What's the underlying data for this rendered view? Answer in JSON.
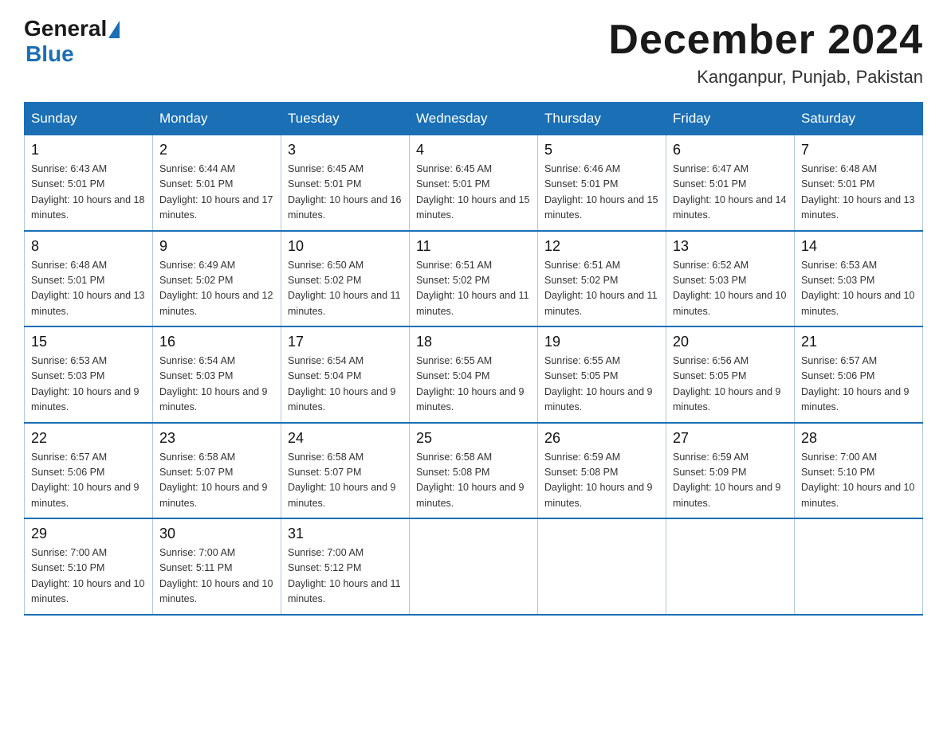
{
  "header": {
    "logo_general": "General",
    "logo_blue": "Blue",
    "title": "December 2024",
    "subtitle": "Kanganpur, Punjab, Pakistan"
  },
  "weekdays": [
    "Sunday",
    "Monday",
    "Tuesday",
    "Wednesday",
    "Thursday",
    "Friday",
    "Saturday"
  ],
  "weeks": [
    [
      {
        "day": "1",
        "sunrise": "6:43 AM",
        "sunset": "5:01 PM",
        "daylight": "10 hours and 18 minutes."
      },
      {
        "day": "2",
        "sunrise": "6:44 AM",
        "sunset": "5:01 PM",
        "daylight": "10 hours and 17 minutes."
      },
      {
        "day": "3",
        "sunrise": "6:45 AM",
        "sunset": "5:01 PM",
        "daylight": "10 hours and 16 minutes."
      },
      {
        "day": "4",
        "sunrise": "6:45 AM",
        "sunset": "5:01 PM",
        "daylight": "10 hours and 15 minutes."
      },
      {
        "day": "5",
        "sunrise": "6:46 AM",
        "sunset": "5:01 PM",
        "daylight": "10 hours and 15 minutes."
      },
      {
        "day": "6",
        "sunrise": "6:47 AM",
        "sunset": "5:01 PM",
        "daylight": "10 hours and 14 minutes."
      },
      {
        "day": "7",
        "sunrise": "6:48 AM",
        "sunset": "5:01 PM",
        "daylight": "10 hours and 13 minutes."
      }
    ],
    [
      {
        "day": "8",
        "sunrise": "6:48 AM",
        "sunset": "5:01 PM",
        "daylight": "10 hours and 13 minutes."
      },
      {
        "day": "9",
        "sunrise": "6:49 AM",
        "sunset": "5:02 PM",
        "daylight": "10 hours and 12 minutes."
      },
      {
        "day": "10",
        "sunrise": "6:50 AM",
        "sunset": "5:02 PM",
        "daylight": "10 hours and 11 minutes."
      },
      {
        "day": "11",
        "sunrise": "6:51 AM",
        "sunset": "5:02 PM",
        "daylight": "10 hours and 11 minutes."
      },
      {
        "day": "12",
        "sunrise": "6:51 AM",
        "sunset": "5:02 PM",
        "daylight": "10 hours and 11 minutes."
      },
      {
        "day": "13",
        "sunrise": "6:52 AM",
        "sunset": "5:03 PM",
        "daylight": "10 hours and 10 minutes."
      },
      {
        "day": "14",
        "sunrise": "6:53 AM",
        "sunset": "5:03 PM",
        "daylight": "10 hours and 10 minutes."
      }
    ],
    [
      {
        "day": "15",
        "sunrise": "6:53 AM",
        "sunset": "5:03 PM",
        "daylight": "10 hours and 9 minutes."
      },
      {
        "day": "16",
        "sunrise": "6:54 AM",
        "sunset": "5:03 PM",
        "daylight": "10 hours and 9 minutes."
      },
      {
        "day": "17",
        "sunrise": "6:54 AM",
        "sunset": "5:04 PM",
        "daylight": "10 hours and 9 minutes."
      },
      {
        "day": "18",
        "sunrise": "6:55 AM",
        "sunset": "5:04 PM",
        "daylight": "10 hours and 9 minutes."
      },
      {
        "day": "19",
        "sunrise": "6:55 AM",
        "sunset": "5:05 PM",
        "daylight": "10 hours and 9 minutes."
      },
      {
        "day": "20",
        "sunrise": "6:56 AM",
        "sunset": "5:05 PM",
        "daylight": "10 hours and 9 minutes."
      },
      {
        "day": "21",
        "sunrise": "6:57 AM",
        "sunset": "5:06 PM",
        "daylight": "10 hours and 9 minutes."
      }
    ],
    [
      {
        "day": "22",
        "sunrise": "6:57 AM",
        "sunset": "5:06 PM",
        "daylight": "10 hours and 9 minutes."
      },
      {
        "day": "23",
        "sunrise": "6:58 AM",
        "sunset": "5:07 PM",
        "daylight": "10 hours and 9 minutes."
      },
      {
        "day": "24",
        "sunrise": "6:58 AM",
        "sunset": "5:07 PM",
        "daylight": "10 hours and 9 minutes."
      },
      {
        "day": "25",
        "sunrise": "6:58 AM",
        "sunset": "5:08 PM",
        "daylight": "10 hours and 9 minutes."
      },
      {
        "day": "26",
        "sunrise": "6:59 AM",
        "sunset": "5:08 PM",
        "daylight": "10 hours and 9 minutes."
      },
      {
        "day": "27",
        "sunrise": "6:59 AM",
        "sunset": "5:09 PM",
        "daylight": "10 hours and 9 minutes."
      },
      {
        "day": "28",
        "sunrise": "7:00 AM",
        "sunset": "5:10 PM",
        "daylight": "10 hours and 10 minutes."
      }
    ],
    [
      {
        "day": "29",
        "sunrise": "7:00 AM",
        "sunset": "5:10 PM",
        "daylight": "10 hours and 10 minutes."
      },
      {
        "day": "30",
        "sunrise": "7:00 AM",
        "sunset": "5:11 PM",
        "daylight": "10 hours and 10 minutes."
      },
      {
        "day": "31",
        "sunrise": "7:00 AM",
        "sunset": "5:12 PM",
        "daylight": "10 hours and 11 minutes."
      },
      null,
      null,
      null,
      null
    ]
  ],
  "labels": {
    "sunrise": "Sunrise:",
    "sunset": "Sunset:",
    "daylight": "Daylight:"
  }
}
